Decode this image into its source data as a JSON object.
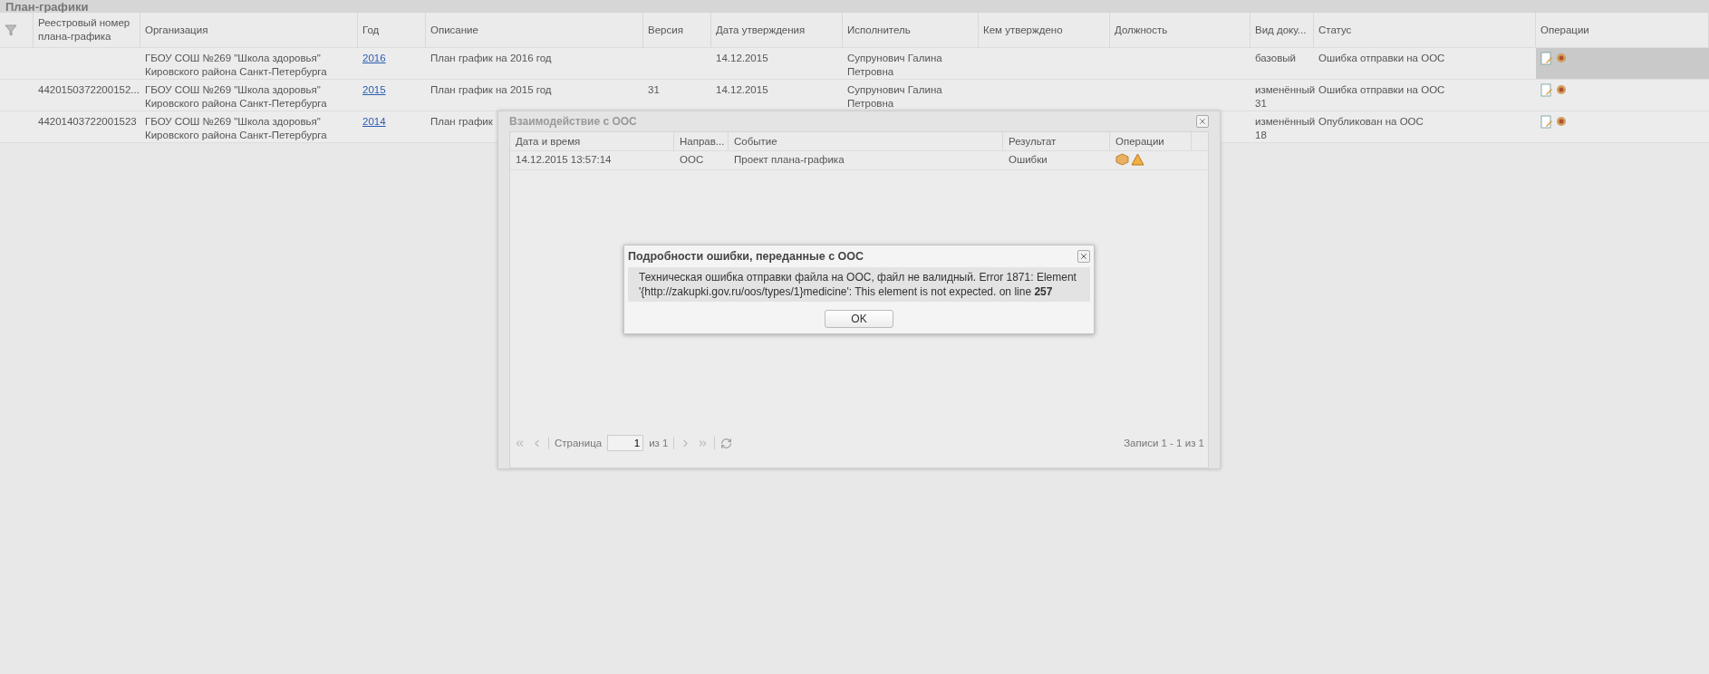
{
  "panel": {
    "title": "План-графики"
  },
  "table": {
    "columns": [
      {
        "label": "Реестровый номер плана-графика"
      },
      {
        "label": "Организация"
      },
      {
        "label": "Год"
      },
      {
        "label": "Описание"
      },
      {
        "label": "Версия"
      },
      {
        "label": "Дата утверждения"
      },
      {
        "label": "Исполнитель"
      },
      {
        "label": "Кем утверждено"
      },
      {
        "label": "Должность"
      },
      {
        "label": "Вид доку..."
      },
      {
        "label": "Статус"
      },
      {
        "label": "Операции"
      }
    ],
    "rows": [
      {
        "selected": true,
        "cells": [
          "",
          "ГБОУ СОШ №269 \"Школа здоровья\" Кировского района Санкт-Петербурга",
          "2016",
          "План график на 2016 год",
          "",
          "14.12.2015",
          "Супрунович Галина Петровна",
          "",
          "",
          "базовый",
          "Ошибка отправки на ООС"
        ]
      },
      {
        "selected": false,
        "cells": [
          "4420150372200152...",
          "ГБОУ СОШ №269 \"Школа здоровья\" Кировского района Санкт-Петербурга",
          "2015",
          "План график на 2015 год",
          "31",
          "14.12.2015",
          "Супрунович Галина Петровна",
          "",
          "",
          "изменённый 31",
          "Ошибка отправки на ООС"
        ]
      },
      {
        "selected": false,
        "cells": [
          "44201403722001523",
          "ГБОУ СОШ №269 \"Школа здоровья\" Кировского района Санкт-Петербурга",
          "2014",
          "План график",
          "",
          "",
          "",
          "",
          "",
          "изменённый 18",
          "Опубликован на ООС"
        ]
      }
    ]
  },
  "dialog": {
    "title": "Взаимодействие с ООС",
    "columns": [
      {
        "label": "Дата и время"
      },
      {
        "label": "Направ..."
      },
      {
        "label": "Событие"
      },
      {
        "label": "Результат"
      },
      {
        "label": "Операции"
      }
    ],
    "rows": [
      {
        "cells": [
          "14.12.2015 13:57:14",
          "ООС",
          "Проект плана-графика",
          "Ошибки"
        ]
      }
    ],
    "pager": {
      "page_label": "Страница",
      "page": "1",
      "of": "из 1",
      "records": "Записи 1 - 1 из 1"
    }
  },
  "error_dialog": {
    "title": "Подробности ошибки, переданные с ООС",
    "message": "Техническая ошибка отправки файла на ООС, файл не валидный. Error 1871: Element '{http://zakupki.gov.ru/oos/types/1}medicine': This element is not expected. on line **257**",
    "button": "OK"
  }
}
